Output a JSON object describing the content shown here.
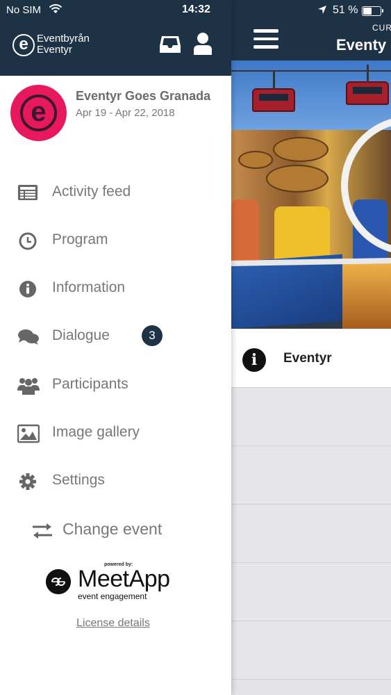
{
  "status_bar": {
    "carrier": "No SIM",
    "time": "14:32",
    "battery": "51 %",
    "battery_level": 0.51
  },
  "drawer": {
    "brand_line1": "Eventbyrån",
    "brand_line2": "Eventyr",
    "brand_logo_letter": "e",
    "event_logo_letter": "e",
    "event_name": "Eventyr Goes Granada",
    "event_dates": "Apr 19 - Apr 22, 2018",
    "menu": [
      {
        "label": "Activity feed",
        "icon": "list-icon"
      },
      {
        "label": "Program",
        "icon": "clock-icon"
      },
      {
        "label": "Information",
        "icon": "info-icon"
      },
      {
        "label": "Dialogue",
        "icon": "chat-icon",
        "badge": "3"
      },
      {
        "label": "Participants",
        "icon": "users-icon"
      },
      {
        "label": "Image gallery",
        "icon": "image-icon"
      },
      {
        "label": "Settings",
        "icon": "gear-icon"
      }
    ],
    "change_event": "Change event",
    "powered_by": "powered by:",
    "meetapp_name": "MeetApp",
    "meetapp_tagline": "event engagement",
    "license_link": "License details"
  },
  "main": {
    "header_sub": "CUR",
    "header_title": "Eventy",
    "info_label": "Eventyr"
  },
  "colors": {
    "header_bg": "#1e3246",
    "event_logo": "#e8185c",
    "badge_bg": "#1e3246",
    "menu_text": "#777777"
  }
}
